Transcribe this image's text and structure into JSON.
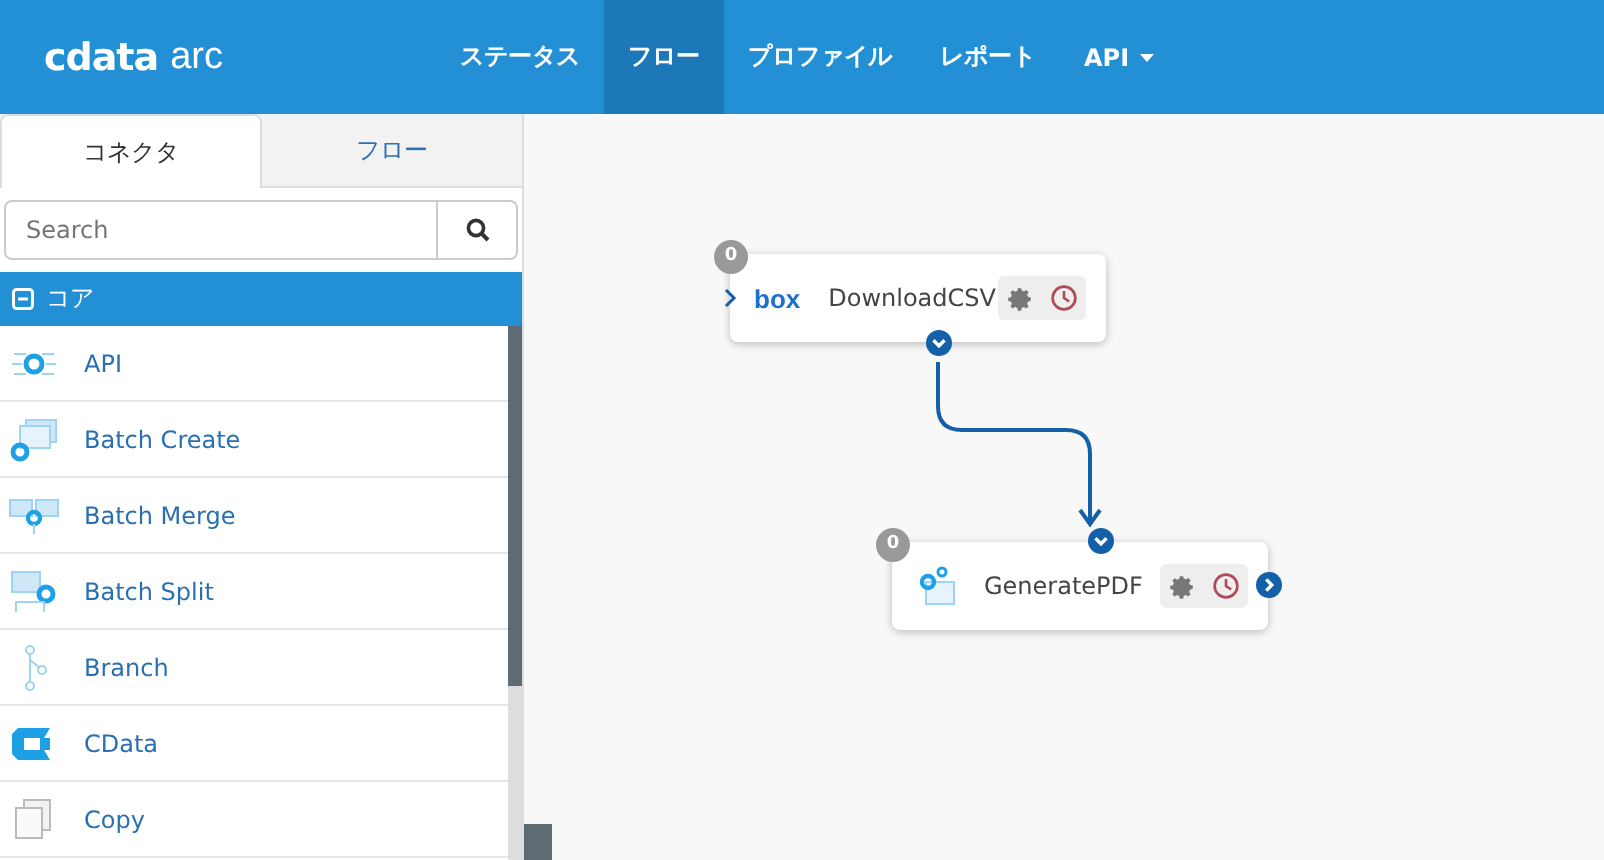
{
  "brand": {
    "logo": "cdata",
    "product": "arc"
  },
  "nav": [
    {
      "label": "ステータス",
      "selected": false,
      "dropdown": false
    },
    {
      "label": "フロー",
      "selected": true,
      "dropdown": false
    },
    {
      "label": "プロファイル",
      "selected": false,
      "dropdown": false
    },
    {
      "label": "レポート",
      "selected": false,
      "dropdown": false
    },
    {
      "label": "API",
      "selected": false,
      "dropdown": true
    }
  ],
  "sidebar": {
    "tabs": [
      {
        "label": "コネクタ",
        "selected": true
      },
      {
        "label": "フロー",
        "selected": false
      }
    ],
    "search": {
      "placeholder": "Search"
    },
    "group": {
      "label": "コア",
      "expanded": true
    },
    "items": [
      {
        "label": "API",
        "kind": "api"
      },
      {
        "label": "Batch Create",
        "kind": "batch-create"
      },
      {
        "label": "Batch Merge",
        "kind": "batch-merge"
      },
      {
        "label": "Batch Split",
        "kind": "batch-split"
      },
      {
        "label": "Branch",
        "kind": "branch"
      },
      {
        "label": "CData",
        "kind": "cdata"
      },
      {
        "label": "Copy",
        "kind": "copy"
      }
    ]
  },
  "flow": {
    "nodes": [
      {
        "name": "DownloadCSV",
        "count": "0",
        "kind": "box",
        "brand": "box"
      },
      {
        "name": "GeneratePDF",
        "count": "0",
        "kind": "generator"
      }
    ]
  }
}
